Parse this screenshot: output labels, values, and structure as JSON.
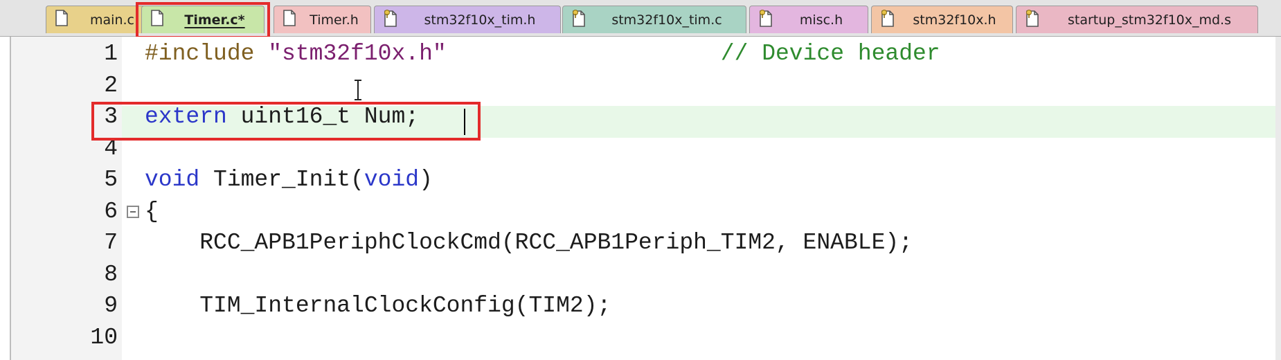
{
  "tabs": [
    {
      "label": "main.c",
      "icon": "file-icon",
      "color": "#e8d18a",
      "active": false
    },
    {
      "label": "Timer.c*",
      "icon": "file-icon",
      "color": "#c8e6a8",
      "active": true
    },
    {
      "label": "Timer.h",
      "icon": "file-icon",
      "color": "#f2c1c1",
      "active": false
    },
    {
      "label": "stm32f10x_tim.h",
      "icon": "file-key-icon",
      "color": "#cdb6e8",
      "active": false
    },
    {
      "label": "stm32f10x_tim.c",
      "icon": "file-key-icon",
      "color": "#a9d3c4",
      "active": false
    },
    {
      "label": "misc.h",
      "icon": "file-key-icon",
      "color": "#e3b6df",
      "active": false
    },
    {
      "label": "stm32f10x.h",
      "icon": "file-key-icon",
      "color": "#f3c5a5",
      "active": false
    },
    {
      "label": "startup_stm32f10x_md.s",
      "icon": "file-key-icon",
      "color": "#eab7c4",
      "active": false
    }
  ],
  "editor": {
    "lines": [
      {
        "num": "1",
        "segments": [
          {
            "t": "#include",
            "c": "pp"
          },
          {
            "t": " ",
            "c": ""
          },
          {
            "t": "\"stm32f10x.h\"",
            "c": "str"
          },
          {
            "t": "                    ",
            "c": ""
          },
          {
            "t": "// Device header",
            "c": "cmt"
          }
        ]
      },
      {
        "num": "2",
        "segments": []
      },
      {
        "num": "3",
        "segments": [
          {
            "t": "extern",
            "c": "kw"
          },
          {
            "t": " uint16_t Num;",
            "c": ""
          }
        ]
      },
      {
        "num": "4",
        "segments": []
      },
      {
        "num": "5",
        "segments": [
          {
            "t": "void",
            "c": "kw"
          },
          {
            "t": " Timer_Init(",
            "c": ""
          },
          {
            "t": "void",
            "c": "kw"
          },
          {
            "t": ")",
            "c": ""
          }
        ]
      },
      {
        "num": "6",
        "segments": [
          {
            "t": "{",
            "c": ""
          }
        ],
        "fold": true
      },
      {
        "num": "7",
        "segments": [
          {
            "t": "    RCC_APB1PeriphClockCmd(RCC_APB1Periph_TIM2, ENABLE);",
            "c": ""
          }
        ]
      },
      {
        "num": "8",
        "segments": []
      },
      {
        "num": "9",
        "segments": [
          {
            "t": "    TIM_InternalClockConfig(TIM2);",
            "c": ""
          }
        ]
      },
      {
        "num": "10",
        "segments": []
      }
    ]
  },
  "colors": {
    "highlight_border": "#e32b2b",
    "current_line_bg": "#e8f8e8",
    "keyword": "#2b37c9",
    "string": "#7b1f6e",
    "comment": "#2e8b2e",
    "preprocessor": "#7f5f20"
  }
}
